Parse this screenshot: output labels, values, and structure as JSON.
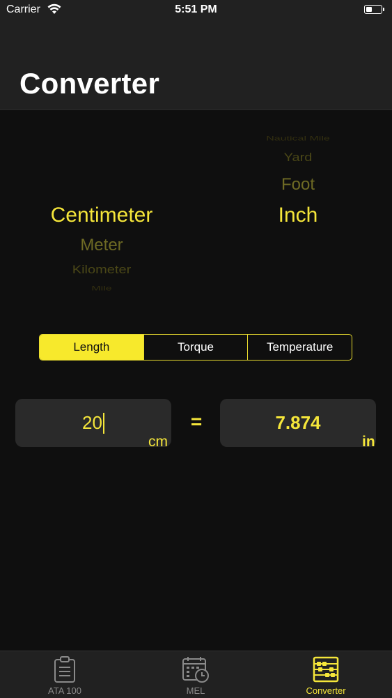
{
  "status_bar": {
    "carrier": "Carrier",
    "time": "5:51 PM"
  },
  "header": {
    "title": "Converter"
  },
  "picker_from": {
    "items": [
      "Centimeter",
      "Meter",
      "Kilometer",
      "Mile"
    ],
    "selected": "Centimeter"
  },
  "picker_to": {
    "items_above": [
      "Nautical Mile",
      "Yard",
      "Foot"
    ],
    "selected": "Inch"
  },
  "segments": {
    "items": [
      "Length",
      "Torque",
      "Temperature"
    ],
    "active": "Length"
  },
  "conversion": {
    "input_value": "20",
    "input_unit": "cm",
    "equals": "=",
    "result_value": "7.874",
    "result_unit": "in"
  },
  "tab_bar": {
    "tabs": [
      {
        "label": "ATA 100",
        "icon": "clipboard-icon",
        "active": false
      },
      {
        "label": "MEL",
        "icon": "calendar-clock-icon",
        "active": false
      },
      {
        "label": "Converter",
        "icon": "abacus-icon",
        "active": true
      }
    ]
  },
  "colors": {
    "accent": "#f5e63a",
    "background": "#0f0f0f",
    "bar": "#212121",
    "field": "#2a2a2a"
  }
}
